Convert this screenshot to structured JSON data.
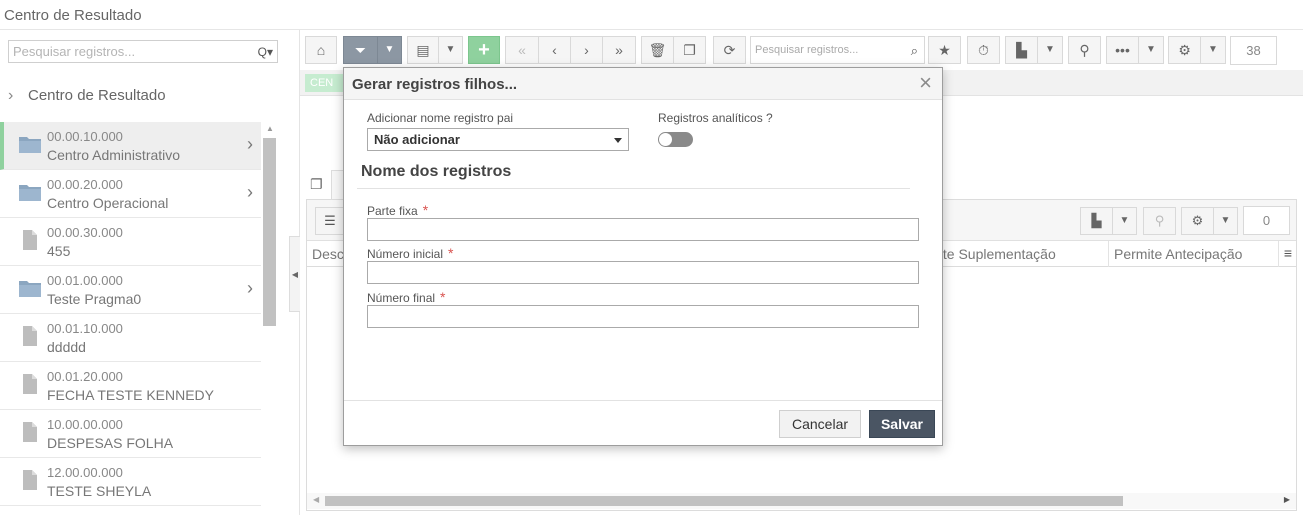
{
  "page": {
    "title": "Centro de Resultado"
  },
  "sidebar": {
    "search_placeholder": "Pesquisar registros...",
    "search_icon_glyph": "Q▾",
    "tree_title": "Centro de Resultado",
    "items": [
      {
        "code": "00.00.10.000",
        "name": "Centro Administrativo",
        "type": "folder",
        "has_children": true,
        "selected": true
      },
      {
        "code": "00.00.20.000",
        "name": "Centro Operacional",
        "type": "folder",
        "has_children": true,
        "selected": false
      },
      {
        "code": "00.00.30.000",
        "name": "455",
        "type": "file",
        "has_children": false,
        "selected": false
      },
      {
        "code": "00.01.00.000",
        "name": "Teste Pragma0",
        "type": "folder",
        "has_children": true,
        "selected": false
      },
      {
        "code": "00.01.10.000",
        "name": "ddddd",
        "type": "file",
        "has_children": false,
        "selected": false
      },
      {
        "code": "00.01.20.000",
        "name": "FECHA TESTE KENNEDY",
        "type": "file",
        "has_children": false,
        "selected": false
      },
      {
        "code": "10.00.00.000",
        "name": "DESPESAS FOLHA",
        "type": "file",
        "has_children": false,
        "selected": false
      },
      {
        "code": "12.00.00.000",
        "name": "TESTE SHEYLA",
        "type": "file",
        "has_children": false,
        "selected": false
      }
    ]
  },
  "toolbar": {
    "search_placeholder": "Pesquisar registros...",
    "record_count": "38",
    "icons": [
      "home-icon",
      "filter-icon",
      "grid-icon",
      "add-icon",
      "first-icon",
      "prev-icon",
      "next-icon",
      "last-icon",
      "delete-icon",
      "copy-icon",
      "refresh-icon",
      "favorite-icon",
      "timer-icon",
      "export-icon",
      "attach-icon",
      "more-icon",
      "settings-icon"
    ]
  },
  "background": {
    "tag_label": "CEN",
    "grid": {
      "record_count": "0",
      "columns": [
        "Desc",
        "nite Suplementação",
        "Permite Antecipação"
      ]
    }
  },
  "modal": {
    "title": "Gerar registros filhos...",
    "parent_name_label": "Adicionar nome registro pai",
    "parent_name_value": "Não adicionar",
    "analytic_label": "Registros analíticos ?",
    "analytic_on": false,
    "section_title": "Nome dos registros",
    "fixed_part_label": "Parte fixa",
    "start_number_label": "Número inicial",
    "end_number_label": "Número final",
    "required_mark": "*",
    "cancel_label": "Cancelar",
    "save_label": "Salvar"
  },
  "colors": {
    "accent_green": "#8fd19e",
    "filter_active": "#8c97a3",
    "save_button": "#4a5563",
    "required": "#d9534f"
  }
}
